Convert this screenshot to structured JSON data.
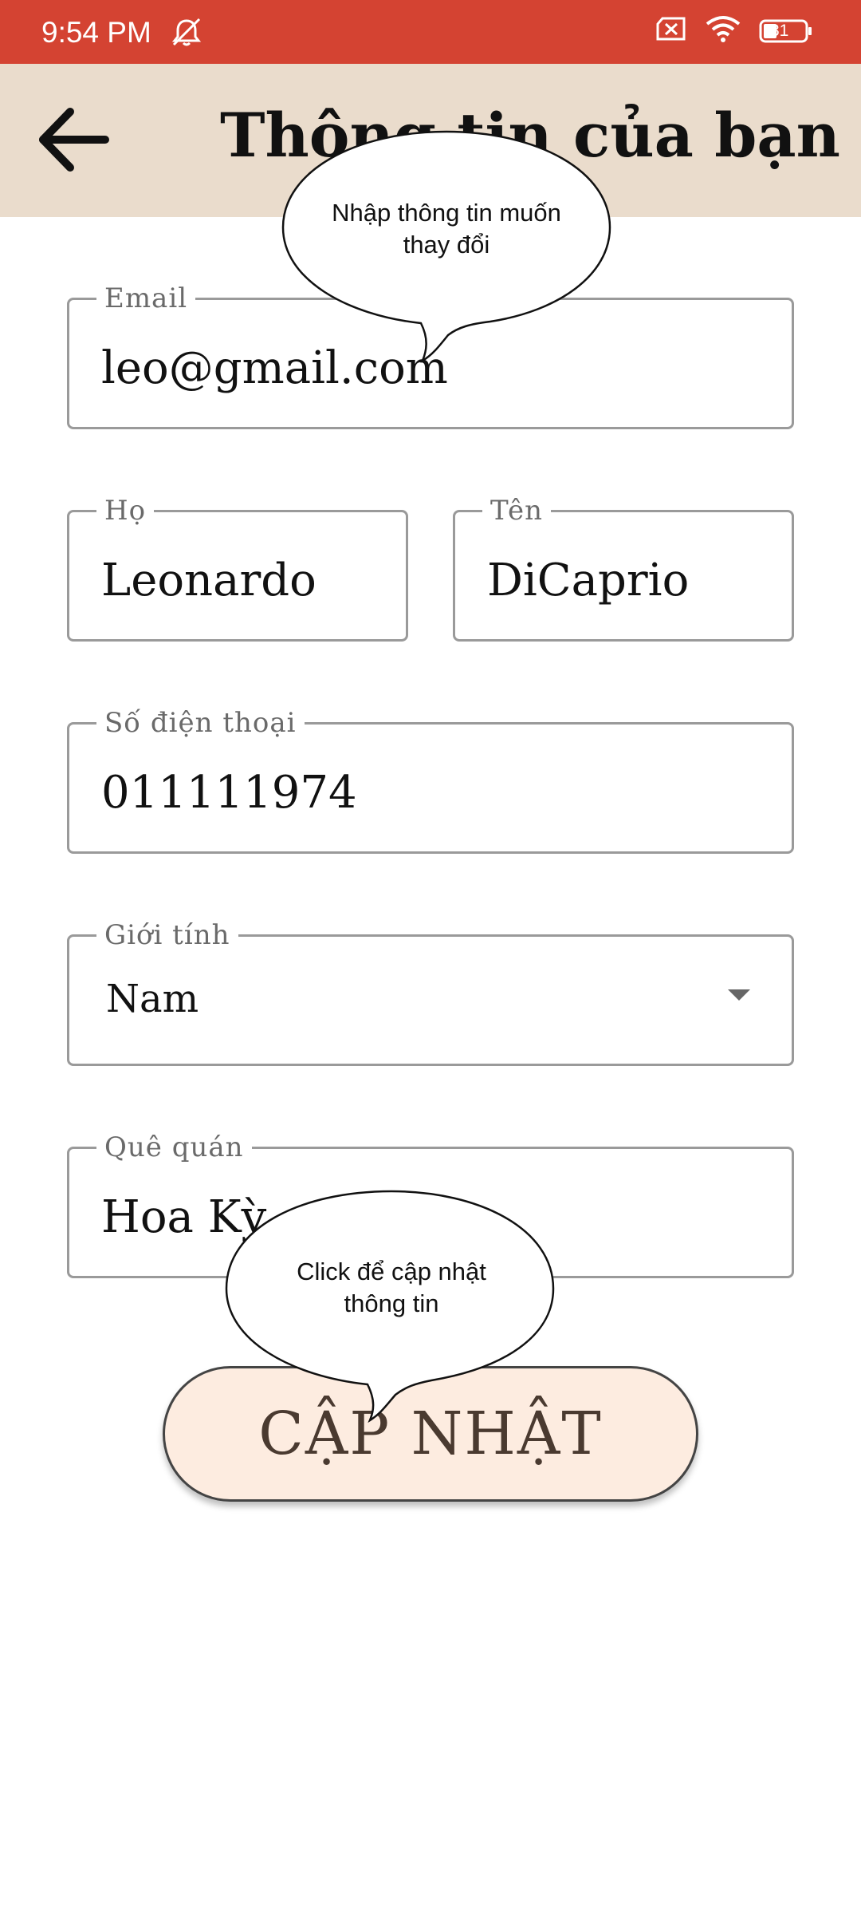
{
  "status_bar": {
    "time": "9:54 PM",
    "battery": "31",
    "icons": [
      "mute-icon",
      "sim-off-icon",
      "wifi-icon",
      "battery-icon"
    ]
  },
  "app_bar": {
    "title": "Thông tin của bạn",
    "back_icon": "arrow-left-icon"
  },
  "form": {
    "email": {
      "label": "Email",
      "value": "leo@gmail.com"
    },
    "last_name": {
      "label": "Họ",
      "value": "Leonardo"
    },
    "first_name": {
      "label": "Tên",
      "value": "DiCaprio"
    },
    "phone": {
      "label": "Số điện thoại",
      "value": "011111974"
    },
    "gender": {
      "label": "Giới tính",
      "value": "Nam"
    },
    "hometown": {
      "label": "Quê quán",
      "value": "Hoa Kỳ"
    }
  },
  "update_button": {
    "label": "CẬP NHẬT"
  },
  "tooltips": {
    "top_line1": "Nhập thông tin muốn",
    "top_line2": "thay đổi",
    "bottom_line1": "Click để cập nhật",
    "bottom_line2": "thông tin"
  },
  "colors": {
    "status_bar": "#d44332",
    "app_bar": "#eadccc",
    "button_bg": "#fdece0"
  }
}
